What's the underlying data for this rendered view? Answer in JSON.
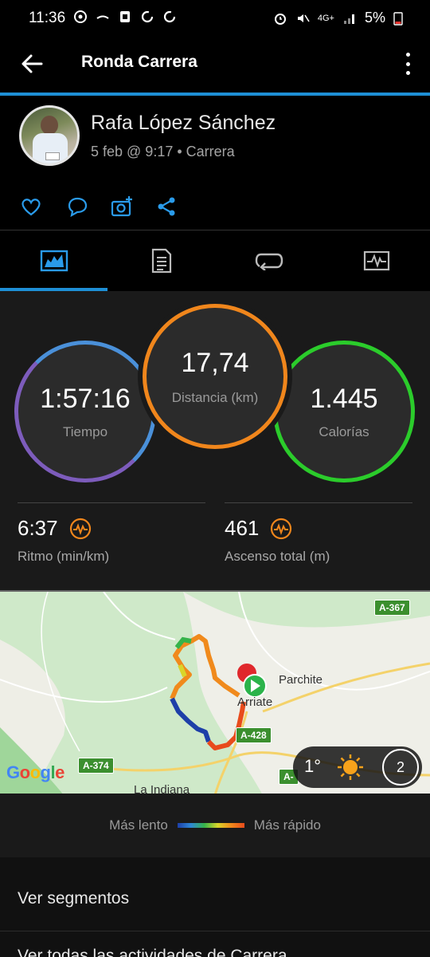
{
  "status_bar": {
    "time": "11:36",
    "network": "4G+",
    "battery": "5%"
  },
  "app_bar": {
    "title": "Ronda Carrera"
  },
  "profile": {
    "name": "Rafa López Sánchez",
    "meta": "5 feb @ 9:17 • Carrera"
  },
  "stats": {
    "time": {
      "value": "1:57:16",
      "label": "Tiempo"
    },
    "distance": {
      "value": "17,74",
      "label": "Distancia (km)"
    },
    "calories": {
      "value": "1.445",
      "label": "Calorías"
    },
    "pace": {
      "value": "6:37",
      "label": "Ritmo (min/km)"
    },
    "ascent": {
      "value": "461",
      "label": "Ascenso total (m)"
    }
  },
  "map": {
    "roads": [
      "A-367",
      "A-428",
      "A-374",
      "A-"
    ],
    "places": [
      "Parchite",
      "Arriate",
      "La Indiana"
    ],
    "brand": "Google",
    "weather": {
      "temp": "1°",
      "wind": "2"
    },
    "colors": {
      "fast": "#e84b1c",
      "slow": "#1d3fa8",
      "start": "#2bb34a",
      "end": "#e0282c"
    }
  },
  "legend": {
    "slow": "Más lento",
    "fast": "Más rápido"
  },
  "list": {
    "segments": "Ver segmentos",
    "all_activities": "Ver todas las actividades de Carrera"
  },
  "colors": {
    "accent": "#1e8fd6",
    "time_ring": "#4a90d9",
    "distance_ring": "#f0861c",
    "calories_ring": "#2bcc2b"
  }
}
